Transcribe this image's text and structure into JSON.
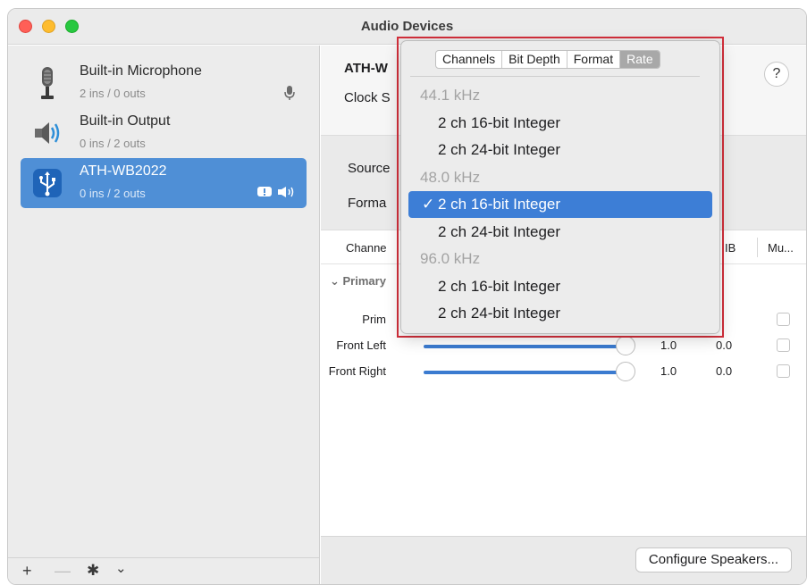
{
  "window": {
    "title": "Audio Devices"
  },
  "sidebar": {
    "devices": [
      {
        "name": "Built-in Microphone",
        "io": "2 ins / 0 outs",
        "icon": "microphone-icon"
      },
      {
        "name": "Built-in Output",
        "io": "0 ins / 2 outs",
        "icon": "speaker-icon"
      },
      {
        "name": "ATH-WB2022",
        "io": "0 ins / 2 outs",
        "icon": "usb-icon",
        "selected": true
      }
    ],
    "footer": {
      "add": "+",
      "remove": "—",
      "gear": "✱",
      "chevron": "⌄"
    }
  },
  "main": {
    "device_title": "ATH-W",
    "clock_label": "Clock S",
    "help": "?",
    "source_label": "Source",
    "format_label": "Forma",
    "table": {
      "col_channel": "Channe",
      "col_db": "IB",
      "col_mute": "Mu...",
      "section": "Primary",
      "rows": [
        {
          "label": "Prim",
          "value": "",
          "db": ""
        },
        {
          "label": "Front Left",
          "value": "1.0",
          "db": "0.0"
        },
        {
          "label": "Front Right",
          "value": "1.0",
          "db": "0.0"
        }
      ]
    },
    "configure_button": "Configure Speakers..."
  },
  "popup": {
    "tabs": [
      "Channels",
      "Bit Depth",
      "Format",
      "Rate"
    ],
    "active_tab": "Rate",
    "groups": [
      {
        "header": "44.1 kHz",
        "items": [
          "2 ch 16-bit Integer",
          "2 ch 24-bit Integer"
        ]
      },
      {
        "header": "48.0 kHz",
        "items": [
          "2 ch 16-bit Integer",
          "2 ch 24-bit Integer"
        ]
      },
      {
        "header": "96.0 kHz",
        "items": [
          "2 ch 16-bit Integer",
          "2 ch 24-bit Integer"
        ]
      }
    ],
    "checkmark": "✓",
    "selected_label": "2 ch 16-bit Integer"
  },
  "colors": {
    "accent": "#3d7ed6",
    "selection_sidebar": "#4f8fd6",
    "highlight_border": "#d32f3b"
  }
}
